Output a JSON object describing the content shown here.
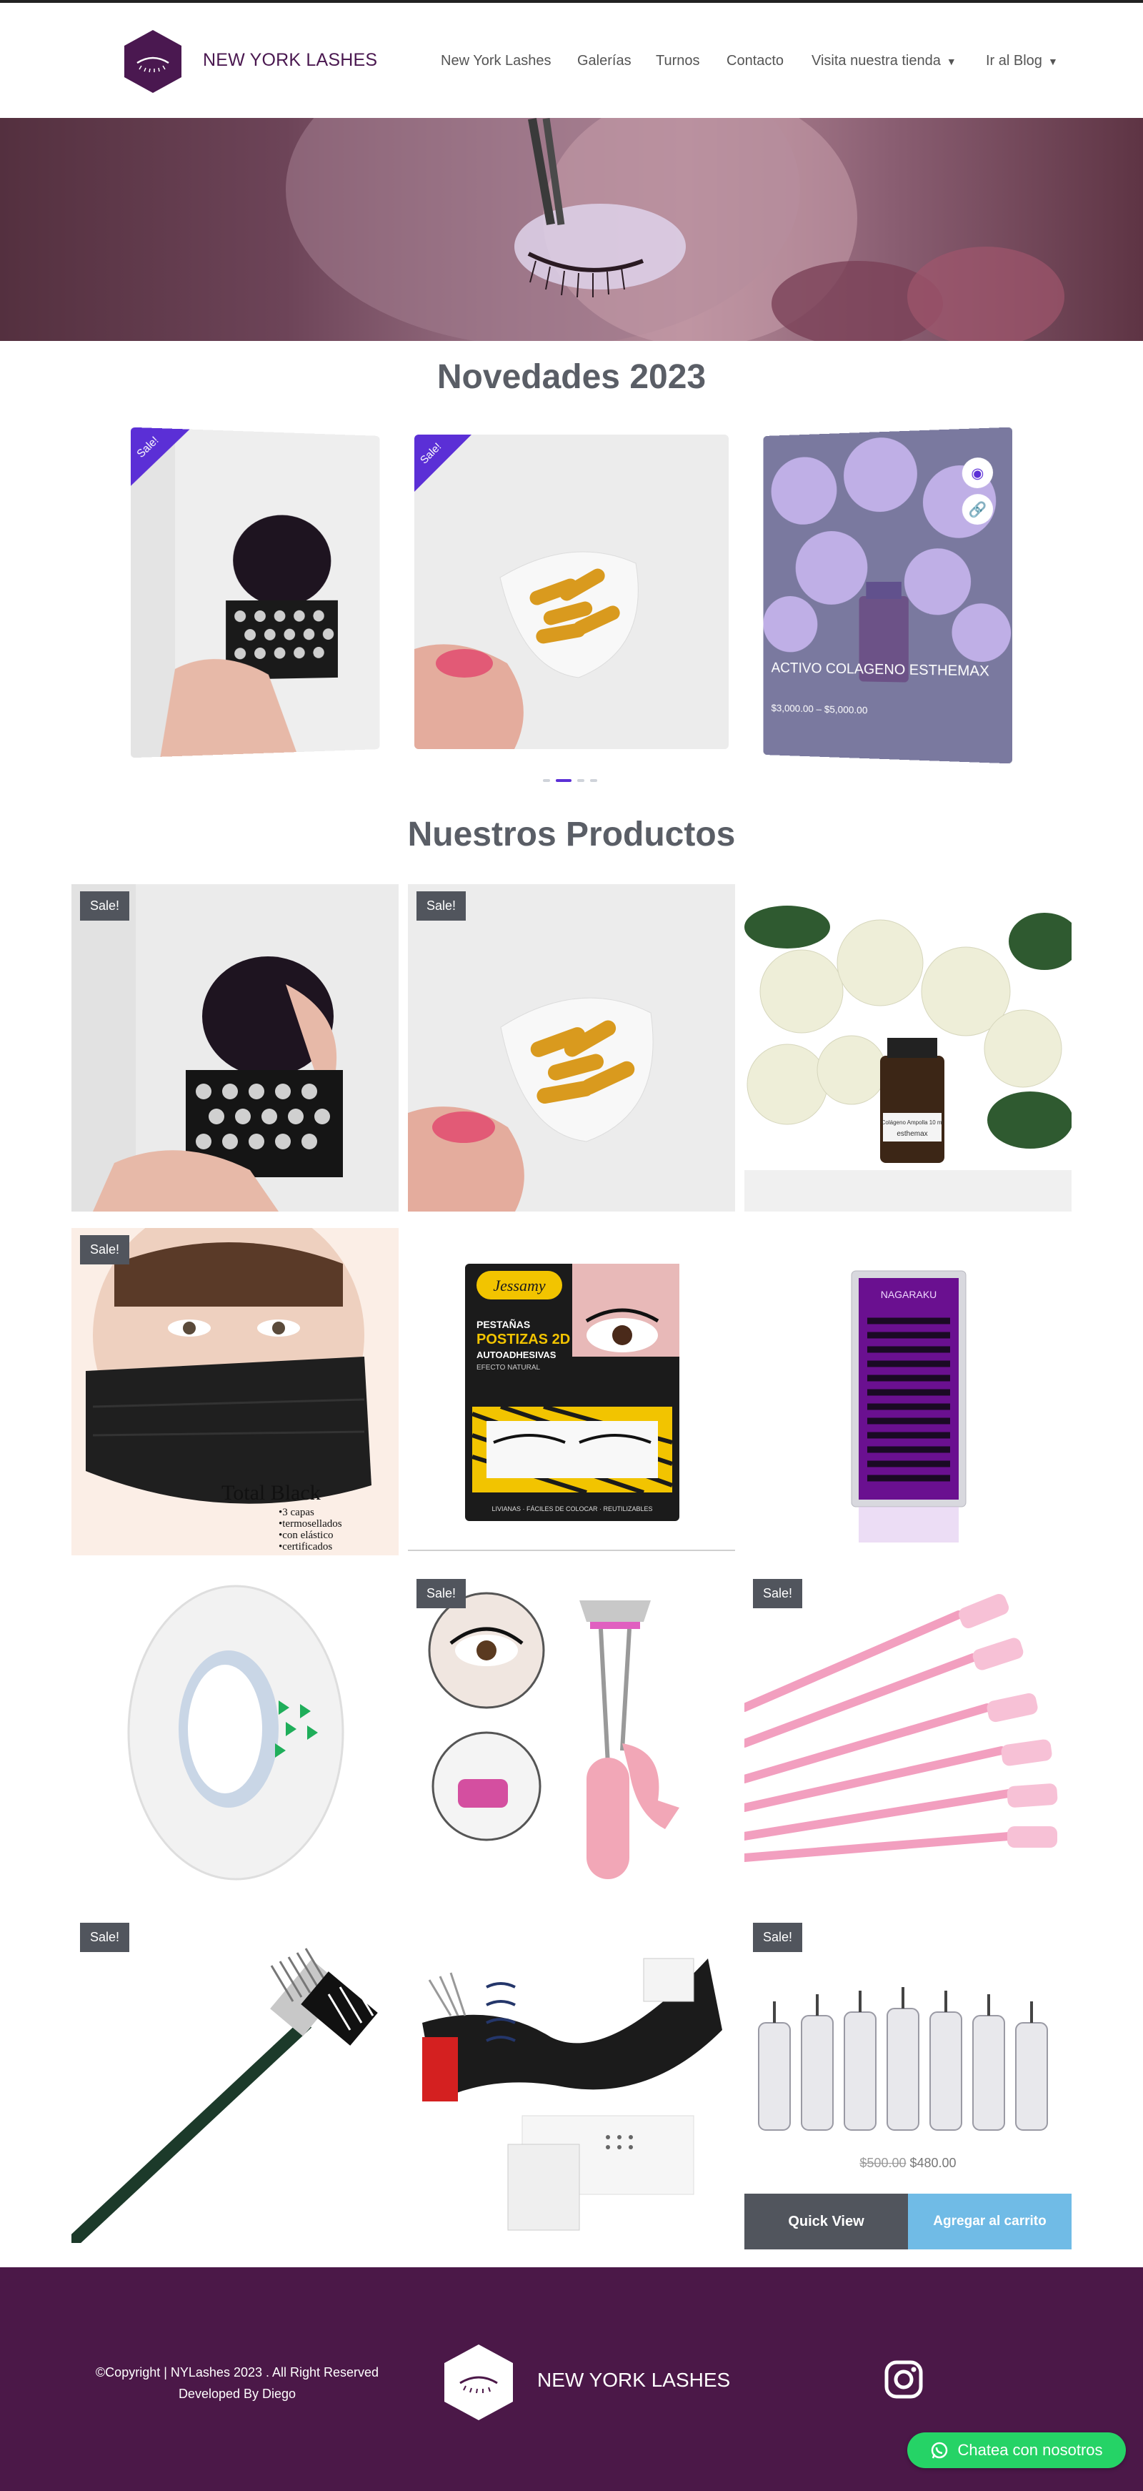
{
  "brand": {
    "name": "NEW YORK LASHES",
    "color": "#4a1850"
  },
  "nav": [
    {
      "label": "New York Lashes"
    },
    {
      "label": "Galerías"
    },
    {
      "label": "Turnos"
    },
    {
      "label": "Contacto"
    },
    {
      "label": "Visita nuestra tienda"
    },
    {
      "label": "Ir al Blog"
    }
  ],
  "sections": {
    "novedades_title": "Novedades 2023",
    "productos_title": "Nuestros Productos"
  },
  "carousel": {
    "sale_label": "Sale!",
    "active_item": {
      "title": "ACTIVO COLAGENO ESTHEMAX",
      "price": "$3,000.00 – $5,000.00"
    },
    "eye_icon": "eye-icon",
    "link_icon": "link-icon"
  },
  "products": {
    "sale_label": "Sale!",
    "last_item": {
      "old_price": "$500.00",
      "new_price": "$480.00"
    },
    "quick_view": "Quick View",
    "add_to_cart": "Agregar al carrito",
    "images": {
      "total_black_title": "Total Black",
      "total_black_lines": [
        "•3 capas",
        "•termosellados",
        "•con elástico",
        "•certificados"
      ],
      "jessamy_brand": "Jessamy",
      "jessamy_lines": [
        "PESTAÑAS",
        "POSTIZAS 2D",
        "AUTOADHESIVAS",
        "EFECTO NATURAL"
      ],
      "jessamy_footer": "LIVIANAS · FÁCILES DE COLOCAR · REUTILIZABLES",
      "nagaraku_label": "NAGARAKU",
      "collagen_label": "Colágeno Ampolla 10 ml",
      "collagen_brand": "esthemax"
    }
  },
  "footer": {
    "copyright": "©Copyright | NYLashes 2023 . All Right Reserved",
    "developer": "Developed By Diego",
    "brand": "NEW YORK LASHES"
  },
  "chat": {
    "label": "Chatea con nosotros",
    "color": "#25d366"
  },
  "colors": {
    "accent": "#5b2fd6",
    "footer_bg": "#4b1848",
    "badge": "#51555d",
    "cart": "#70bbe6"
  }
}
